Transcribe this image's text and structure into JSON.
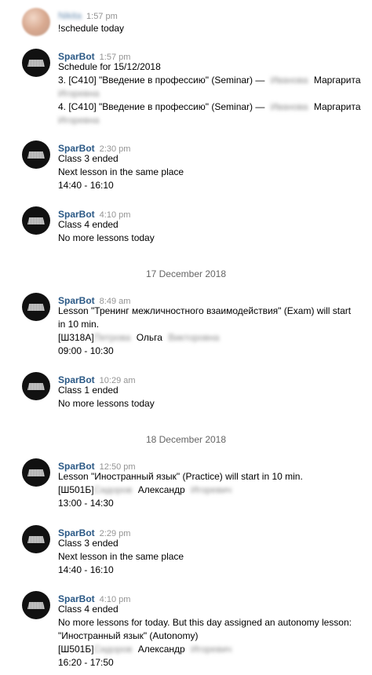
{
  "messages": [
    {
      "sender": "Nikita",
      "time": "1:57 pm",
      "lines": [
        "!schedule today"
      ]
    },
    {
      "sender": "SparBot",
      "time": "1:57 pm",
      "lines": [
        "Schedule for 15/12/2018",
        "3. [С410] \"Введение в профессию\" (Seminar) —",
        "Маргарита",
        "Игоревна",
        "4. [С410] \"Введение в профессию\" (Seminar) —",
        "Маргарита",
        "Игоревна"
      ],
      "blurred": [
        "Иванова",
        "Иванова"
      ]
    },
    {
      "sender": "SparBot",
      "time": "2:30 pm",
      "lines": [
        "Class 3 ended",
        "Next lesson in the same place",
        "14:40 - 16:10"
      ]
    },
    {
      "sender": "SparBot",
      "time": "4:10 pm",
      "lines": [
        "Class 4 ended",
        "No more lessons today"
      ]
    },
    {
      "sender": "SparBot",
      "time": "8:49 am",
      "lines": [
        "Lesson \"Тренинг межличностного взаимодействия\" (Exam) will start",
        "in 10 min.",
        "[Ш318А]",
        "Ольга",
        "09:00 - 10:30"
      ],
      "blurred": [
        "Петрова",
        "Викторовна"
      ]
    },
    {
      "sender": "SparBot",
      "time": "10:29 am",
      "lines": [
        "Class 1 ended",
        "No more lessons today"
      ]
    },
    {
      "sender": "SparBot",
      "time": "12:50 pm",
      "lines": [
        "Lesson \"Иностранный язык\" (Practice) will start in 10 min.",
        "[Ш501Б]",
        "Александр",
        "13:00 - 14:30"
      ],
      "blurred": [
        "Сидоров",
        "Игоревич"
      ]
    },
    {
      "sender": "SparBot",
      "time": "2:29 pm",
      "lines": [
        "Class 3 ended",
        "Next lesson in the same place",
        "14:40 - 16:10"
      ]
    },
    {
      "sender": "SparBot",
      "time": "4:10 pm",
      "lines": [
        "Class 4 ended",
        "No more lessons for today. But this day assigned an autonomy lesson:",
        "\"Иностранный язык\" (Autonomy)",
        "[Ш501Б]",
        "Александр",
        "16:20 - 17:50"
      ],
      "blurred": [
        "Сидоров",
        "Игоревич"
      ]
    }
  ],
  "dividers": [
    "17 December 2018",
    "18 December 2018"
  ]
}
